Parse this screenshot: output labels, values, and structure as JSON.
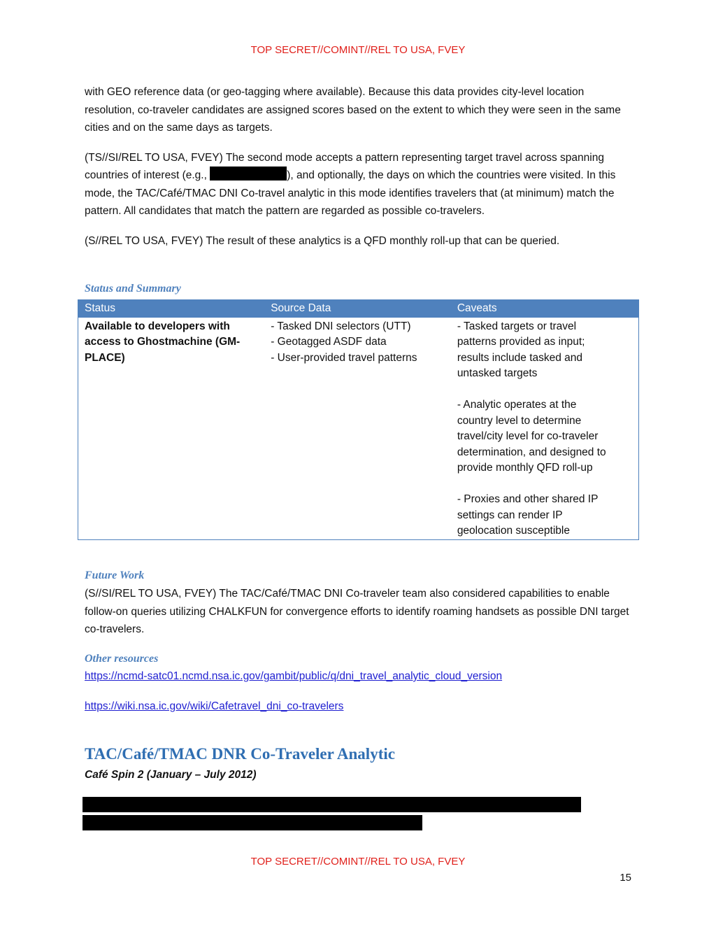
{
  "classification": {
    "top": "TOP SECRET//COMINT//REL TO USA, FVEY",
    "bottom": "TOP SECRET//COMINT//REL TO USA, FVEY"
  },
  "page_number": "15",
  "paragraphs": {
    "p1": "with GEO reference data (or geo-tagging where available). Because this data provides city-level location resolution, co-traveler candidates are assigned scores based on the extent to which they were seen in the same cities and on the same days as targets.",
    "p2_before": "(TS//SI/REL TO USA, FVEY) The second mode accepts a pattern representing target travel across spanning countries of interest (e.g., ",
    "p2_after": "), and optionally, the days on which the countries were visited.  In this mode, the TAC/Café/TMAC DNI Co-travel analytic in this mode identifies travelers that (at minimum) match the pattern.  All candidates that match the pattern are regarded as possible co-travelers.",
    "p3": " (S//REL TO USA, FVEY) The result of these analytics is a QFD monthly roll-up that can be queried."
  },
  "status_summary": {
    "heading": "Status and Summary",
    "columns": [
      "Status",
      "Source Data",
      "Caveats"
    ],
    "status_lines": [
      "Available to developers with",
      "access to Ghostmachine (GM-",
      "PLACE)"
    ],
    "source_lines": [
      "- Tasked DNI selectors (UTT)",
      "- Geotagged ASDF data",
      "- User-provided travel patterns"
    ],
    "caveat_groups": [
      [
        "- Tasked targets or travel",
        "patterns provided as input;",
        "results include tasked and",
        "untasked targets"
      ],
      [
        "- Analytic operates at the",
        "country level to determine",
        "travel/city level for co-traveler",
        "determination, and designed to",
        "provide monthly QFD roll-up"
      ],
      [
        "- Proxies and other shared IP",
        "settings can render IP",
        "geolocation susceptible"
      ]
    ]
  },
  "future_work": {
    "heading": "Future Work",
    "text": "(S//SI/REL TO USA, FVEY) The TAC/Café/TMAC DNI Co-traveler team also considered capabilities to enable follow-on queries utilizing CHALKFUN for convergence efforts to identify roaming handsets as possible DNI target co-travelers."
  },
  "other_resources": {
    "heading": "Other resources",
    "links": [
      "https://ncmd-satc01.ncmd.nsa.ic.gov/gambit/public/q/dni_travel_analytic_cloud_version",
      "https://wiki.nsa.ic.gov/wiki/Cafetravel_dni_co-travelers"
    ]
  },
  "section": {
    "title": "TAC/Café/TMAC DNR Co-Traveler Analytic",
    "subtitle": "Café Spin 2 (January – July 2012)"
  }
}
